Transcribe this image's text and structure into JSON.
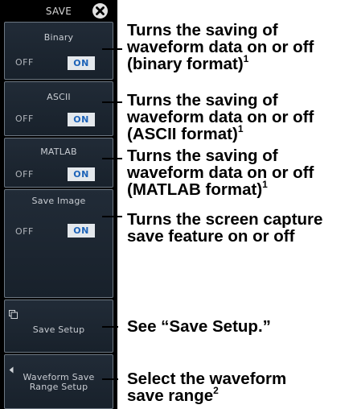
{
  "panel": {
    "title": "SAVE",
    "keys": [
      {
        "label": "Binary",
        "off_label": "OFF",
        "on_label": "ON"
      },
      {
        "label": "ASCII",
        "off_label": "OFF",
        "on_label": "ON"
      },
      {
        "label": "MATLAB",
        "off_label": "OFF",
        "on_label": "ON"
      },
      {
        "label": "Save Image",
        "off_label": "OFF",
        "on_label": "ON"
      },
      {
        "label": "Save Setup",
        "icon": "submenu-icon"
      },
      {
        "label_line1": "Waveform Save",
        "label_line2": "Range Setup",
        "icon": "left-arrow-icon"
      }
    ]
  },
  "callouts": [
    {
      "lines": [
        "Turns the saving of",
        "waveform data on or off",
        "(binary format)"
      ],
      "note": "1"
    },
    {
      "lines": [
        "Turns the saving of",
        "waveform data on or off",
        "(ASCII format)"
      ],
      "note": "1"
    },
    {
      "lines": [
        "Turns the saving of",
        "waveform data on or off",
        "(MATLAB format)"
      ],
      "note": "1"
    },
    {
      "lines": [
        "Turns the screen capture",
        "save feature on or off"
      ]
    },
    {
      "lines": [
        "See “Save Setup.”"
      ]
    },
    {
      "lines": [
        "Select the waveform",
        "save range"
      ],
      "note": "2"
    }
  ],
  "colors": {
    "panel_bg": "#000000",
    "key_border": "#6c7782",
    "on_text": "#1d63b8",
    "on_badge_bg": "#e4e8ec"
  }
}
